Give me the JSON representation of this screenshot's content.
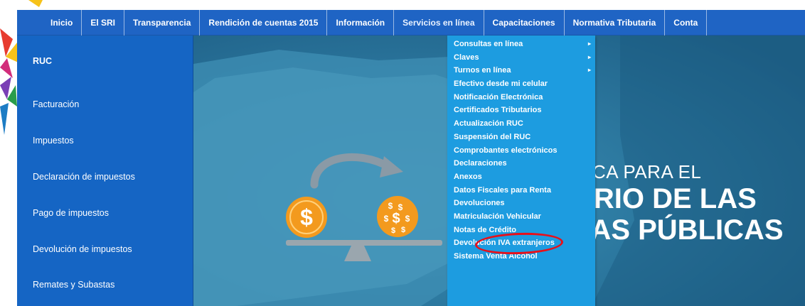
{
  "topnav": {
    "items": [
      {
        "label": "Inicio"
      },
      {
        "label": "El SRI"
      },
      {
        "label": "Transparencia"
      },
      {
        "label": "Rendición de cuentas 2015"
      },
      {
        "label": "Información"
      },
      {
        "label": "Servicios en línea",
        "active": true
      },
      {
        "label": "Capacitaciones"
      },
      {
        "label": "Normativa Tributaria"
      },
      {
        "label": "Conta"
      }
    ]
  },
  "sidebar": {
    "items": [
      {
        "label": "RUC"
      },
      {
        "label": "Facturación"
      },
      {
        "label": "Impuestos"
      },
      {
        "label": "Declaración de impuestos"
      },
      {
        "label": "Pago de impuestos"
      },
      {
        "label": "Devolución de impuestos"
      },
      {
        "label": "Remates y Subastas"
      },
      {
        "label": ""
      }
    ]
  },
  "dropdown": {
    "items": [
      {
        "label": "Consultas en línea",
        "submenu": true
      },
      {
        "label": "Claves",
        "submenu": true
      },
      {
        "label": "Turnos en línea",
        "submenu": true
      },
      {
        "label": "Efectivo desde mi celular"
      },
      {
        "label": "Notificación Electrónica"
      },
      {
        "label": "Certificados Tributarios"
      },
      {
        "label": "Actualización RUC"
      },
      {
        "label": "Suspensión del RUC"
      },
      {
        "label": "Comprobantes electrónicos"
      },
      {
        "label": "Declaraciones"
      },
      {
        "label": "Anexos"
      },
      {
        "label": "Datos Fiscales para Renta"
      },
      {
        "label": "Devoluciones"
      },
      {
        "label": "Matriculación Vehicular",
        "highlighted": true
      },
      {
        "label": "Notas de Crédito"
      },
      {
        "label": "Devolución IVA extranjeros"
      },
      {
        "label": "Sistema Venta Alcohol"
      }
    ]
  },
  "hero": {
    "line1": "NICA PARA EL",
    "line2": "BRIO DE LAS",
    "line3": "ZAS PÚBLICAS",
    "coin_symbol": "$"
  },
  "colors": {
    "nav_bg": "#1f64c4",
    "sidebar_bg": "#1565c4",
    "dropdown_bg": "#1d9ce0",
    "hero_bg": "#2f7fa6",
    "annotation": "#e8101a",
    "coin": "#f39a1e"
  },
  "icons": {
    "submenu": "chevron-right-icon",
    "arrow": "curved-arrow-icon",
    "scale": "balance-scale-icon"
  }
}
